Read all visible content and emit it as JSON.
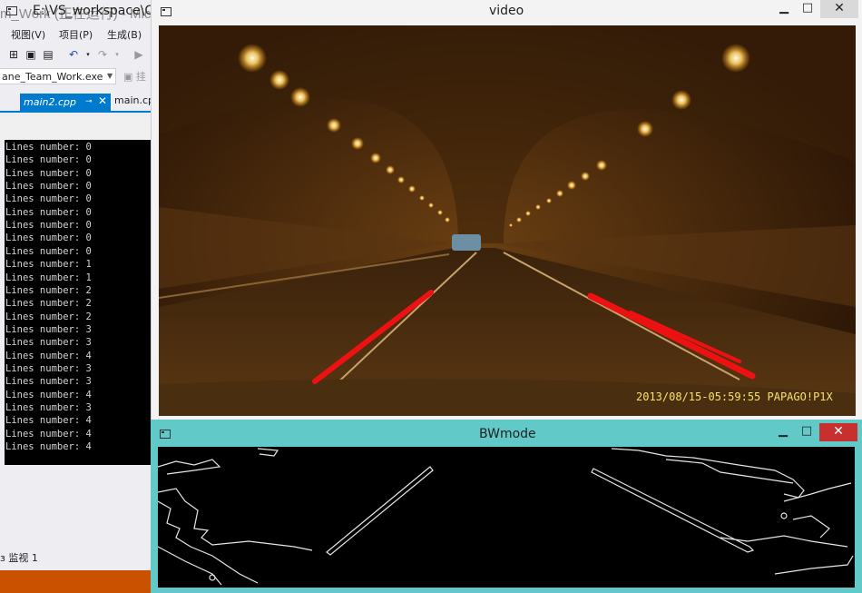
{
  "vs": {
    "title": "m_Work (正在运行) - Micro",
    "menu": [
      "视图(V)",
      "项目(P)",
      "生成(B)"
    ],
    "target": "ane_Team_Work.exe",
    "attach_label": "挂",
    "tabs": {
      "active": "main2.cpp",
      "active_pin": "⊸",
      "active_close": "✕",
      "second": "main.cp"
    },
    "panel_label": "监视 1",
    "panel_label_prefix": "ɜ",
    "colors": {
      "accent": "#007acc",
      "statusbar": "#ca5100"
    }
  },
  "console": {
    "title": "E:\\VS_workspace\\C+",
    "lines": [
      "Lines number: 0",
      "Lines number: 0",
      "Lines number: 0",
      "Lines number: 0",
      "Lines number: 0",
      "Lines number: 0",
      "Lines number: 0",
      "Lines number: 0",
      "Lines number: 0",
      "Lines number: 1",
      "Lines number: 1",
      "Lines number: 2",
      "Lines number: 2",
      "Lines number: 2",
      "Lines number: 3",
      "Lines number: 3",
      "Lines number: 4",
      "Lines number: 3",
      "Lines number: 3",
      "Lines number: 4",
      "Lines number: 3",
      "Lines number: 4",
      "Lines number: 4",
      "Lines number: 4"
    ]
  },
  "video_window": {
    "title": "video",
    "minimize": "▁",
    "maximize": "□",
    "close": "✕",
    "timestamp": "2013/08/15-05:59:55 PAPAGO!P1X",
    "lane_color": "#ee1111"
  },
  "bw_window": {
    "title": "BWmode",
    "minimize": "▁",
    "maximize": "□",
    "close": "✕"
  }
}
